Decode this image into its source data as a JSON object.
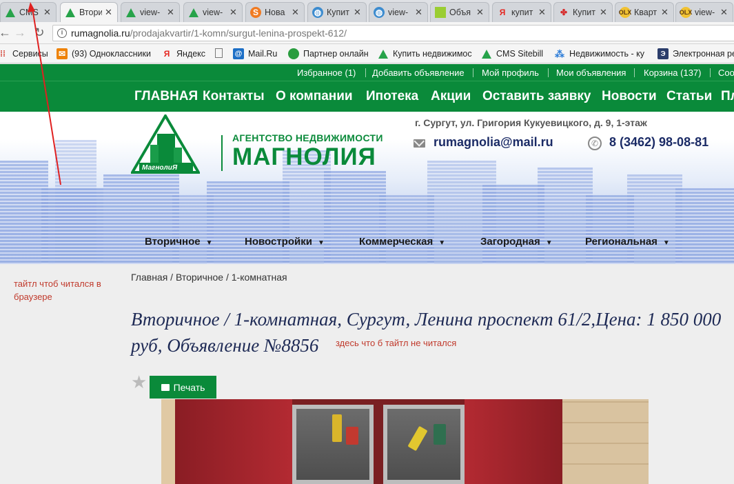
{
  "browser": {
    "tabs": [
      {
        "title": "CMS",
        "icon": "tree-icon"
      },
      {
        "title": "Втори",
        "icon": "tree-icon"
      },
      {
        "title": "view-",
        "icon": "tree-icon"
      },
      {
        "title": "view-",
        "icon": "tree-icon"
      },
      {
        "title": "Нова",
        "icon": "s-icon",
        "glyph": "S"
      },
      {
        "title": "Купит",
        "icon": "globe-icon"
      },
      {
        "title": "view-",
        "icon": "globe-icon"
      },
      {
        "title": "Объя",
        "icon": "grid-icon"
      },
      {
        "title": "купит",
        "icon": "yandex-icon",
        "glyph": "Я"
      },
      {
        "title": "Купит",
        "icon": "red-icon",
        "glyph": "✤"
      },
      {
        "title": "Кварт",
        "icon": "olx-icon",
        "glyph": "OLX"
      },
      {
        "title": "view-",
        "icon": "olx-icon",
        "glyph": "OLX"
      }
    ],
    "url_host": "rumagnolia.ru",
    "url_path": "/prodajakvartir/1-komn/surgut-lenina-prospekt-612/",
    "bookmarks": [
      {
        "label": "Сервисы"
      },
      {
        "label": "(93) Одноклассники"
      },
      {
        "label": "Яндекс"
      },
      {
        "label": ""
      },
      {
        "label": "Mail.Ru"
      },
      {
        "label": "Партнер онлайн"
      },
      {
        "label": "Купить недвижимос"
      },
      {
        "label": "CMS Sitebill"
      },
      {
        "label": "Недвижимость - ку"
      },
      {
        "label": "Электронная ре"
      }
    ]
  },
  "site": {
    "toplinks": [
      "Избранное (1)",
      "Добавить объявление",
      "Мой профиль",
      "Мои объявления",
      "Корзина (137)",
      "Соо"
    ],
    "mainnav": [
      "ГЛАВНАЯ",
      "Контакты",
      "О компании",
      "Ипотека",
      "Акции",
      "Оставить заявку",
      "Новости",
      "Статьи",
      "Пл"
    ],
    "logo_sub": "АГЕНТСТВО НЕДВИЖИМОСТИ",
    "logo_name": "МАГНОЛИЯ",
    "logo_badge": "МагнолиЯ",
    "address": "г. Сургут, ул. Григория Кукуевицкого, д. 9, 1-этаж",
    "email": "rumagnolia@mail.ru",
    "phone": "8 (3462) 98-08-81",
    "categories": [
      "Вторичное",
      "Новостройки",
      "Коммерческая",
      "Загородная",
      "Региональная"
    ]
  },
  "content": {
    "note_left": "тайтл чтоб читался в браузере",
    "breadcrumb": "Главная / Вторичное / 1-комнатная",
    "title": "Вторичное / 1-комнатная, Сургут, Ленина проспект 61/2,Цена: 1 850 000 руб, Объявление №8856",
    "note_title": "здесь что б тайтл не читался",
    "print_label": "Печать"
  },
  "colors": {
    "brand_green": "#0a8a3a",
    "title_navy": "#1e2a55",
    "annotation_red": "#c0392b"
  }
}
